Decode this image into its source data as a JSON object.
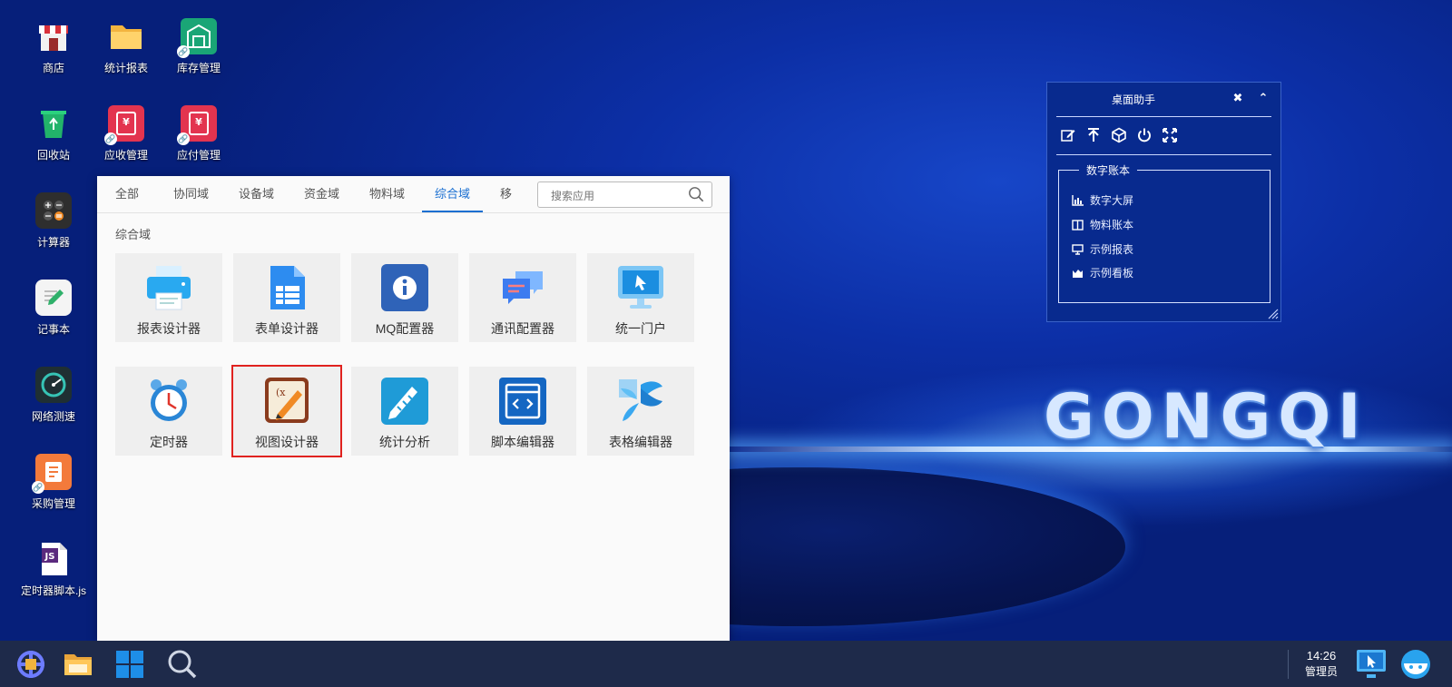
{
  "desktop": {
    "brand_text": "GONGQI",
    "icons": [
      {
        "label": "商店",
        "icon": "store-icon"
      },
      {
        "label": "统计报表",
        "icon": "folder-icon"
      },
      {
        "label": "库存管理",
        "icon": "warehouse-icon"
      },
      {
        "label": "回收站",
        "icon": "recycle-bin-icon"
      },
      {
        "label": "应收管理",
        "icon": "receivable-icon"
      },
      {
        "label": "应付管理",
        "icon": "payable-icon"
      },
      {
        "label": "计算器",
        "icon": "calculator-icon"
      },
      {
        "label": "记事本",
        "icon": "notepad-icon"
      },
      {
        "label": "网络测速",
        "icon": "speedometer-icon"
      },
      {
        "label": "采购管理",
        "icon": "purchase-icon"
      },
      {
        "label": "定时器脚本.js",
        "icon": "js-file-icon"
      }
    ]
  },
  "launcher": {
    "tabs": [
      "全部",
      "协同域",
      "设备域",
      "资金域",
      "物料域",
      "综合域",
      "移动"
    ],
    "active_tab": "综合域",
    "search_placeholder": "搜索应用",
    "section_title": "综合域",
    "apps": [
      {
        "label": "报表设计器",
        "icon": "printer-icon"
      },
      {
        "label": "表单设计器",
        "icon": "form-icon"
      },
      {
        "label": "MQ配置器",
        "icon": "info-icon"
      },
      {
        "label": "通讯配置器",
        "icon": "chat-icon"
      },
      {
        "label": "统一门户",
        "icon": "portal-monitor-icon"
      },
      {
        "label": "定时器",
        "icon": "alarm-clock-icon"
      },
      {
        "label": "视图设计器",
        "icon": "view-designer-icon",
        "selected": true
      },
      {
        "label": "统计分析",
        "icon": "ruler-pencil-icon"
      },
      {
        "label": "脚本编辑器",
        "icon": "code-window-icon"
      },
      {
        "label": "表格编辑器",
        "icon": "table-editor-icon"
      }
    ]
  },
  "assistant": {
    "title": "桌面助手",
    "group_title": "数字账本",
    "items": [
      {
        "label": "数字大屏",
        "icon": "bar-chart-icon"
      },
      {
        "label": "物料账本",
        "icon": "book-icon"
      },
      {
        "label": "示例报表",
        "icon": "monitor-icon"
      },
      {
        "label": "示例看板",
        "icon": "dashboard-chart-icon"
      }
    ]
  },
  "taskbar": {
    "time": "14:26",
    "user": "管理员"
  }
}
